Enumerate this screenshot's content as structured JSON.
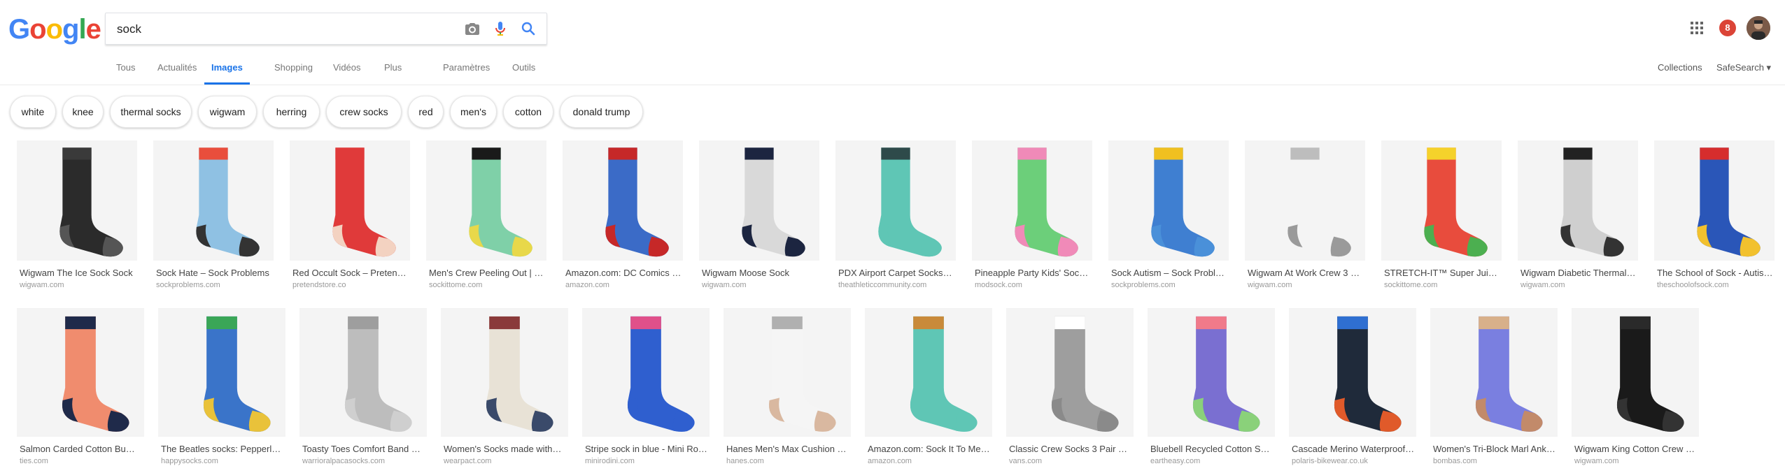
{
  "logo": {
    "letters": [
      "G",
      "o",
      "o",
      "g",
      "l",
      "e"
    ],
    "colors": [
      "#4285F4",
      "#EA4335",
      "#FBBC05",
      "#4285F4",
      "#34A853",
      "#EA4335"
    ]
  },
  "search": {
    "value": "sock",
    "placeholder": ""
  },
  "icons": {
    "camera": "camera-icon",
    "mic": "mic-icon",
    "search": "search-icon",
    "apps": "apps-grid-icon"
  },
  "header": {
    "notifications": "8"
  },
  "tabs": [
    "Tous",
    "Actualités",
    "Images",
    "Shopping",
    "Vidéos",
    "Plus",
    "Paramètres",
    "Outils"
  ],
  "tabs_right": {
    "collections": "Collections",
    "safesearch": "SafeSearch ▾"
  },
  "chips": [
    "white",
    "knee",
    "thermal socks",
    "wigwam",
    "herring",
    "crew socks",
    "red",
    "men's",
    "cotton",
    "donald trump"
  ],
  "results_row1": [
    {
      "title": "Wigwam The Ice Sock Sock",
      "site": "wigwam.com",
      "colors": [
        "#2b2b2b",
        "#3a3a3a",
        "#555555"
      ]
    },
    {
      "title": "Sock Hate – Sock Problems",
      "site": "sockproblems.com",
      "colors": [
        "#8fc1e3",
        "#e94e3c",
        "#333333"
      ]
    },
    {
      "title": "Red Occult Sock – Pretend…",
      "site": "pretendstore.co",
      "colors": [
        "#e03a3a",
        "#e03a3a",
        "#f3d2c1"
      ]
    },
    {
      "title": "Men's Crew Peeling Out | C…",
      "site": "sockittome.com",
      "colors": [
        "#7fd0a8",
        "#1a1a1a",
        "#e8d84a"
      ]
    },
    {
      "title": "Amazon.com: DC Comics …",
      "site": "amazon.com",
      "colors": [
        "#3b6bc7",
        "#c62828",
        "#c62828"
      ]
    },
    {
      "title": "Wigwam Moose Sock",
      "site": "wigwam.com",
      "colors": [
        "#d9d9d9",
        "#1c2540",
        "#1c2540"
      ]
    },
    {
      "title": "PDX Airport Carpet Socks |…",
      "site": "theathleticcommunity.com",
      "colors": [
        "#5fc6b5",
        "#2e4a4a",
        "#5fc6b5"
      ]
    },
    {
      "title": "Pineapple Party Kids' Sock…",
      "site": "modsock.com",
      "colors": [
        "#6ccf7a",
        "#f08ab8",
        "#f08ab8"
      ]
    },
    {
      "title": "Sock Autism – Sock Proble…",
      "site": "sockproblems.com",
      "colors": [
        "#3f7fd1",
        "#f0c020",
        "#4a90d9"
      ]
    },
    {
      "title": "Wigwam At Work Crew 3 P…",
      "site": "wigwam.com",
      "colors": [
        "#f4f4f4",
        "#bdbdbd",
        "#9a9a9a"
      ]
    },
    {
      "title": "STRETCH-IT™ Super Juic…",
      "site": "sockittome.com",
      "colors": [
        "#e84c3d",
        "#f5d22b",
        "#4caf50"
      ]
    },
    {
      "title": "Wigwam Diabetic Thermal …",
      "site": "wigwam.com",
      "colors": [
        "#cfcfcf",
        "#222222",
        "#333333"
      ]
    },
    {
      "title": "The School of Sock - Autis…",
      "site": "theschoolofsock.com",
      "colors": [
        "#2a56b8",
        "#d62d2d",
        "#f2c12e"
      ]
    }
  ],
  "results_row2": [
    {
      "title": "Salmon Carded Cotton Bu…",
      "site": "ties.com",
      "colors": [
        "#f08c6e",
        "#1f2a4a",
        "#1f2a4a"
      ]
    },
    {
      "title": "The Beatles socks: Pepperl…",
      "site": "happysocks.com",
      "colors": [
        "#3a74c9",
        "#3aa657",
        "#e9c23a"
      ]
    },
    {
      "title": "Toasty Toes Comfort Band …",
      "site": "warrioralpacasocks.com",
      "colors": [
        "#bdbdbd",
        "#9e9e9e",
        "#cfcfcf"
      ]
    },
    {
      "title": "Women's Socks made with…",
      "site": "wearpact.com",
      "colors": [
        "#e8e2d6",
        "#8a3a3a",
        "#3a4a6a"
      ]
    },
    {
      "title": "Stripe sock in blue - Mini Rodini",
      "site": "minirodini.com",
      "colors": [
        "#2f5fcf",
        "#e0508a",
        "#2f5fcf"
      ]
    },
    {
      "title": "Hanes Men's Max Cushion …",
      "site": "hanes.com",
      "colors": [
        "#f5f5f5",
        "#b0b0b0",
        "#d9b8a0"
      ]
    },
    {
      "title": "Amazon.com: Sock It To Me, T…",
      "site": "amazon.com",
      "colors": [
        "#5fc6b5",
        "#c98a3a",
        "#5fc6b5"
      ]
    },
    {
      "title": "Classic Crew Socks 3 Pair Pac…",
      "site": "vans.com",
      "colors": [
        "#9e9e9e",
        "#ffffff",
        "#8a8a8a"
      ]
    },
    {
      "title": "Bluebell Recycled Cotton Socks …",
      "site": "eartheasy.com",
      "colors": [
        "#7a6fd1",
        "#f07a8a",
        "#8ad17a"
      ]
    },
    {
      "title": "Cascade Merino Waterproof Sock",
      "site": "polaris-bikewear.co.uk",
      "colors": [
        "#1f2a3a",
        "#2f6fd1",
        "#e05a2a"
      ]
    },
    {
      "title": "Women's Tri-Block Marl Ankle …",
      "site": "bombas.com",
      "colors": [
        "#7a7fe0",
        "#d8b08a",
        "#c28a6a"
      ]
    },
    {
      "title": "Wigwam King Cotton Crew Sock",
      "site": "wigwam.com",
      "colors": [
        "#1a1a1a",
        "#2a2a2a",
        "#333333"
      ]
    }
  ]
}
